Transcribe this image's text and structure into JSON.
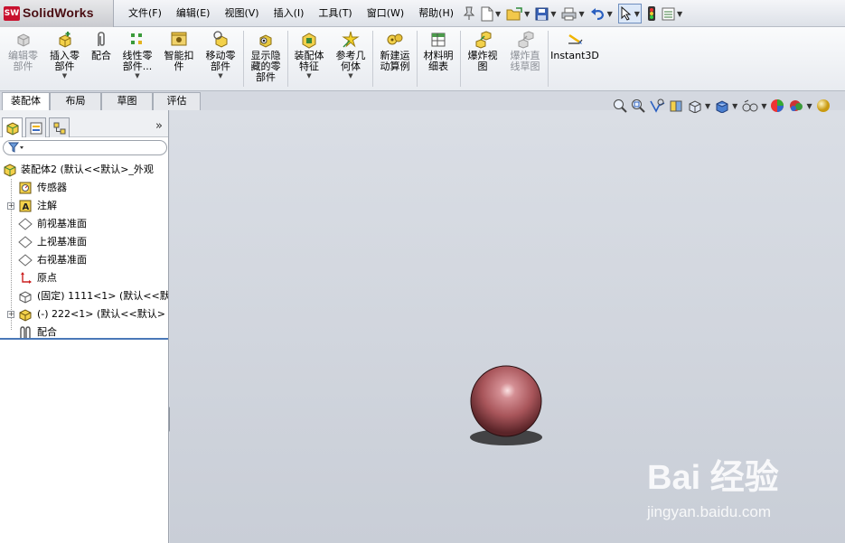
{
  "app": {
    "badge": "SW",
    "name": "SolidWorks"
  },
  "menu": [
    "文件(F)",
    "编辑(E)",
    "视图(V)",
    "插入(I)",
    "工具(T)",
    "窗口(W)",
    "帮助(H)"
  ],
  "ribbon": {
    "edit_component": "编辑零部件",
    "insert_component": "插入零部件",
    "mate": "配合",
    "linear_pattern": "线性零部件...",
    "smart_fasteners": "智能扣件",
    "move_component": "移动零部件",
    "show_hidden": "显示隐藏的零部件",
    "assembly_feature": "装配体特征",
    "reference_geometry": "参考几何体",
    "new_motion_study": "新建运动算例",
    "bom": "材料明细表",
    "exploded_view": "爆炸视图",
    "explode_line_sketch": "爆炸直线草图",
    "instant3d": "Instant3D"
  },
  "tabs": [
    "装配体",
    "布局",
    "草图",
    "评估"
  ],
  "panel": {
    "expand": "»"
  },
  "tree": [
    {
      "label": "装配体2 (默认<<默认>_外观",
      "icon": "assembly-icon"
    },
    {
      "label": "传感器",
      "icon": "sensor-icon"
    },
    {
      "label": "注解",
      "icon": "annotation-icon"
    },
    {
      "label": "前视基准面",
      "icon": "plane-icon"
    },
    {
      "label": "上视基准面",
      "icon": "plane-icon"
    },
    {
      "label": "右视基准面",
      "icon": "plane-icon"
    },
    {
      "label": "原点",
      "icon": "origin-icon"
    },
    {
      "label": "(固定) 1111<1> (默认<<默",
      "icon": "part-icon"
    },
    {
      "label": "(-) 222<1> (默认<<默认>",
      "icon": "part-icon"
    },
    {
      "label": "配合",
      "icon": "mates-icon"
    }
  ],
  "watermark": {
    "line1": "Bai 经验",
    "line2": "jingyan.baidu.com"
  },
  "colors": {
    "sphere": "#a8555a",
    "accent": "#c8102e",
    "viewport": "#d2d6de"
  }
}
